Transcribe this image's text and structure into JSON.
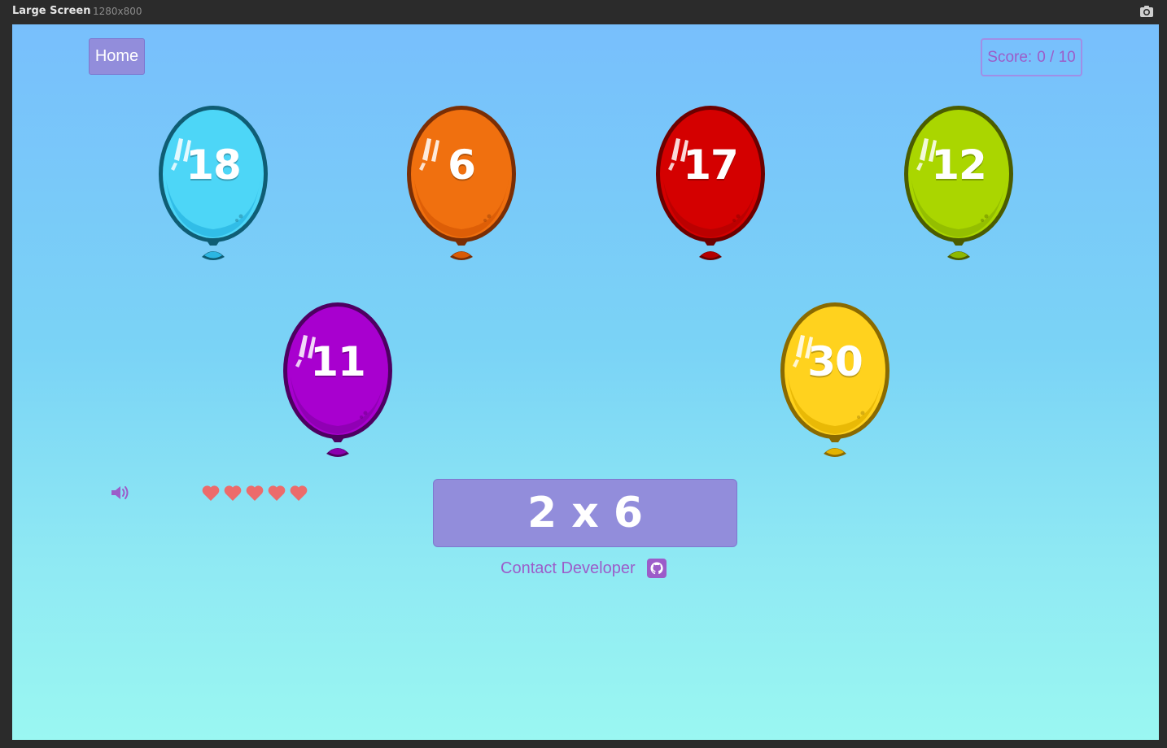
{
  "window": {
    "title": "Large Screen",
    "dimensions": "1280x800",
    "camera_icon": "camera-icon"
  },
  "header": {
    "home_label": "Home",
    "score_label": "Score:",
    "score_value": "0 / 10"
  },
  "balloons": [
    {
      "number": "18",
      "color": "#4dd6f7",
      "dark": "#0f5d74",
      "shade": "#2bb6e2"
    },
    {
      "number": "6",
      "color": "#f0700f",
      "dark": "#7a2e05",
      "shade": "#d85a05"
    },
    {
      "number": "17",
      "color": "#d40000",
      "dark": "#6c0000",
      "shade": "#b40000"
    },
    {
      "number": "12",
      "color": "#aad600",
      "dark": "#4b5c00",
      "shade": "#8eb800"
    },
    {
      "number": "11",
      "color": "#a800cf",
      "dark": "#4d0061",
      "shade": "#8a00ad"
    },
    {
      "number": "30",
      "color": "#ffd21e",
      "dark": "#8a6a00",
      "shade": "#e3b300"
    }
  ],
  "lives": {
    "hearts": 5,
    "heart_color": "#ec6b6b",
    "icon": "heart-icon"
  },
  "sound": {
    "icon": "speaker-icon",
    "color": "#9c5cc9"
  },
  "question": {
    "text": "2 x 6"
  },
  "footer": {
    "contact_label": "Contact Developer",
    "icon": "github-icon"
  },
  "colors": {
    "button_bg": "#928ddb",
    "accent_text": "#9c5cc9",
    "sky_top": "#78bffc",
    "sky_bottom": "#9af7f2"
  }
}
